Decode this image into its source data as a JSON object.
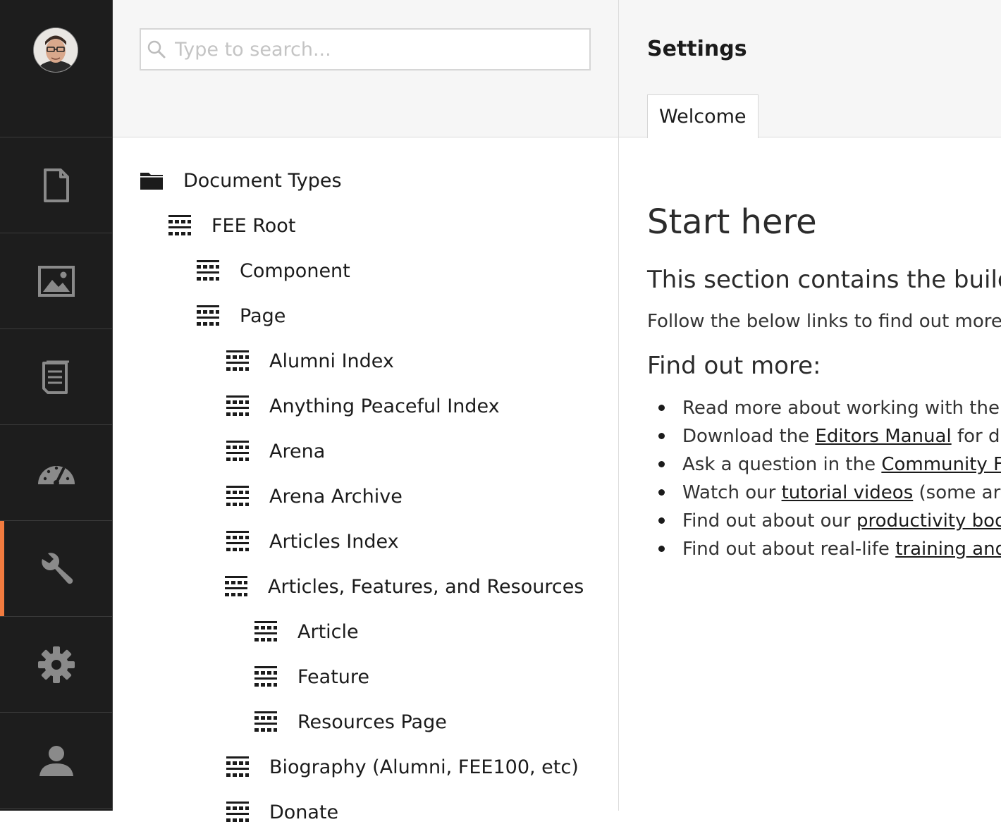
{
  "nav": {
    "accent_color": "#f27b3f",
    "sections": [
      {
        "icon": "document-icon"
      },
      {
        "icon": "image-icon"
      },
      {
        "icon": "form-icon"
      },
      {
        "icon": "dashboard-icon"
      },
      {
        "icon": "wrench-icon",
        "active": true
      },
      {
        "icon": "gear-icon"
      },
      {
        "icon": "user-icon"
      }
    ]
  },
  "search": {
    "placeholder": "Type to search..."
  },
  "tree": {
    "root": "Document Types",
    "items": [
      {
        "label": "FEE Root",
        "level": 1
      },
      {
        "label": "Component",
        "level": 2
      },
      {
        "label": "Page",
        "level": 2
      },
      {
        "label": "Alumni Index",
        "level": 3
      },
      {
        "label": "Anything Peaceful Index",
        "level": 3
      },
      {
        "label": "Arena",
        "level": 3
      },
      {
        "label": "Arena Archive",
        "level": 3
      },
      {
        "label": "Articles Index",
        "level": 3
      },
      {
        "label": "Articles, Features, and Resources",
        "level": 3
      },
      {
        "label": "Article",
        "level": 4
      },
      {
        "label": "Feature",
        "level": 4
      },
      {
        "label": "Resources Page",
        "level": 4
      },
      {
        "label": "Biography (Alumni, FEE100, etc)",
        "level": 3
      },
      {
        "label": "Donate",
        "level": 3
      }
    ]
  },
  "content": {
    "title": "Settings",
    "tab": "Welcome",
    "heading": "Start here",
    "lead": "This section contains the buildi",
    "follow": "Follow the below links to find out more",
    "findout": "Find out more:",
    "links": [
      {
        "before": "Read more about working with the",
        "link": "",
        "after": ""
      },
      {
        "before": "Download the ",
        "link": "Editors Manual",
        "after": " for d"
      },
      {
        "before": "Ask a question in the ",
        "link": "Community F",
        "after": ""
      },
      {
        "before": "Watch our ",
        "link": "tutorial videos",
        "after": " (some ar"
      },
      {
        "before": "Find out about our ",
        "link": "productivity boo",
        "after": ""
      },
      {
        "before": "Find out about real-life ",
        "link": "training and",
        "after": ""
      }
    ]
  }
}
